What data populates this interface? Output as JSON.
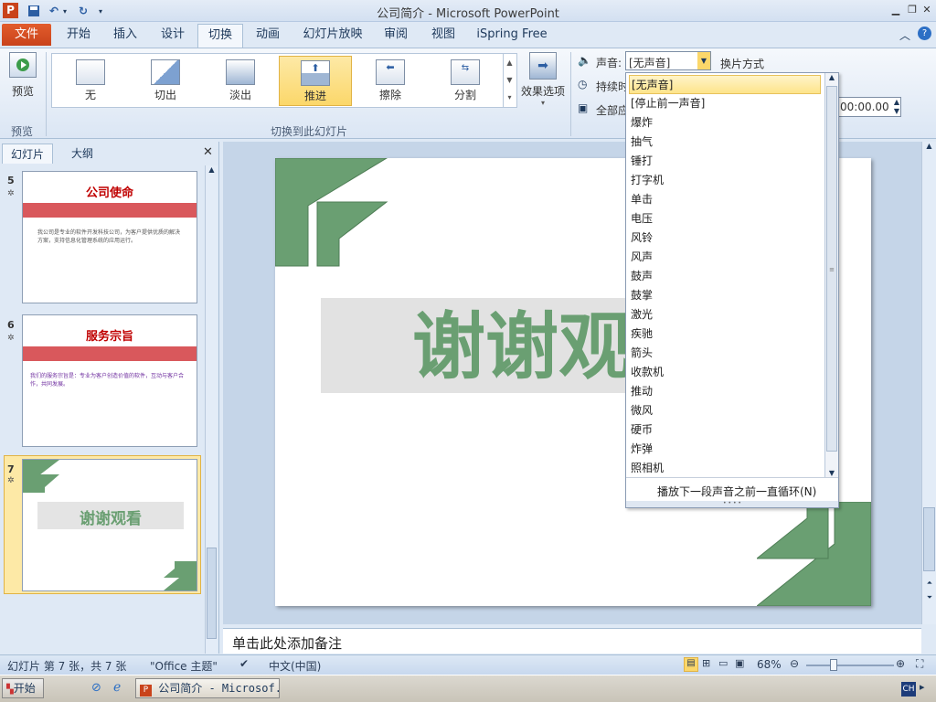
{
  "window": {
    "title": "公司简介 - Microsoft PowerPoint"
  },
  "tabs": [
    "文件",
    "开始",
    "插入",
    "设计",
    "切换",
    "动画",
    "幻灯片放映",
    "审阅",
    "视图",
    "iSpring Free"
  ],
  "ribbon": {
    "preview_label": "预览",
    "preview_group": "预览",
    "transitions": [
      "无",
      "切出",
      "淡出",
      "推进",
      "擦除",
      "分割"
    ],
    "effect_options": "效果选项",
    "transition_group": "切换到此幻灯片",
    "sound_label": "声音:",
    "sound_value": "[无声音]",
    "advance_label": "换片方式",
    "duration_label": "持续时",
    "apply_all_label": "全部应",
    "time_value": "00:00.00"
  },
  "panel": {
    "tab_slides": "幻灯片",
    "tab_outline": "大纲",
    "slides": [
      {
        "num": "5",
        "title": "公司使命",
        "body": "我公司是专业的软件开发科技公司，为客户提供优质的解决方案，支持信息化管理系统的应用运行。"
      },
      {
        "num": "6",
        "title": "服务宗旨",
        "body": "我们的服务宗旨是：专业为客户创造价值的软件，互动与客户合作，共同发展。"
      },
      {
        "num": "7",
        "title": "谢谢观看",
        "body": ""
      }
    ]
  },
  "slide": {
    "text": "谢谢观看"
  },
  "notes": {
    "placeholder": "单击此处添加备注"
  },
  "dropdown": {
    "items": [
      "[无声音]",
      "[停止前一声音]",
      "爆炸",
      "抽气",
      "锤打",
      "打字机",
      "单击",
      "电压",
      "风铃",
      "风声",
      "鼓声",
      "鼓掌",
      "激光",
      "疾驰",
      "箭头",
      "收款机",
      "推动",
      "微风",
      "硬币",
      "炸弹",
      "照相机"
    ],
    "loop_label": "播放下一段声音之前一直循环(N)"
  },
  "status": {
    "slide_info": "幻灯片 第 7 张，共 7 张",
    "theme": "\"Office 主题\"",
    "language": "中文(中国)",
    "zoom": "68%"
  },
  "taskbar": {
    "start": "开始",
    "task": "公司简介 - Microsof...",
    "ime": "CH"
  },
  "colors": {
    "green": "#6a9f72",
    "red": "#c0504d",
    "accent": "#e25c2c"
  }
}
